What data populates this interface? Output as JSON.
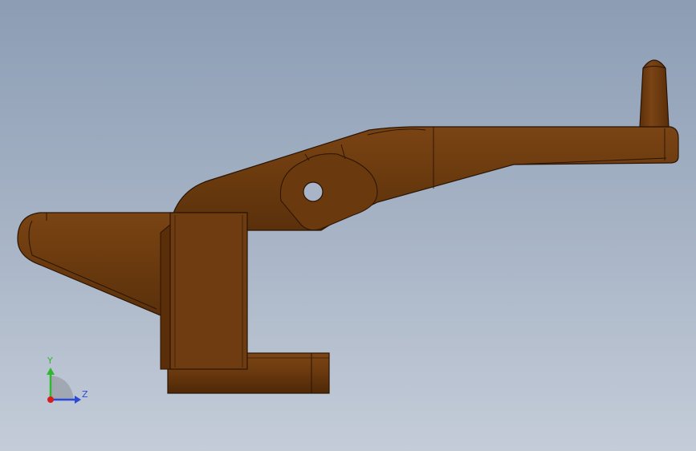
{
  "viewport": {
    "background_top": "#8c9db4",
    "background_bottom": "#c4ccd8"
  },
  "model": {
    "part_color": "#6b3a10",
    "part_dark": "#4a2608",
    "part_light": "#8a5220",
    "edge_color": "#2a1404"
  },
  "triad": {
    "y_label": "Y",
    "z_label": "Z",
    "y_color": "#2fb82f",
    "z_color": "#2b49d8",
    "x_color": "#d81c1c"
  }
}
